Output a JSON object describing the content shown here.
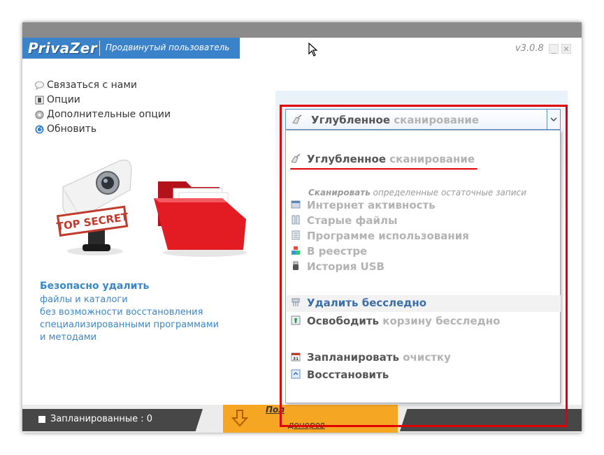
{
  "app": {
    "logo": "PrivaZer",
    "mode": "Продвинутый пользователь",
    "version": "v3.0.8"
  },
  "window_controls": {
    "minimize": "_",
    "close": "✕"
  },
  "menu": [
    {
      "label": "Связаться с нами",
      "icon": "speech-bubble-icon"
    },
    {
      "label": "Опции",
      "icon": "options-icon"
    },
    {
      "label": "Дополнительные опции",
      "icon": "gear-icon"
    },
    {
      "label": "Обновить",
      "icon": "refresh-icon"
    }
  ],
  "illustration": {
    "stamp": "TOP SECRET"
  },
  "description": {
    "heading": "Безопасно удалить",
    "lines": [
      "файлы и каталоги",
      "без возможности восстановления",
      "специализированными программами",
      "и методами"
    ]
  },
  "combo": {
    "bold": "Углубленное",
    "light": "сканирование"
  },
  "dropdown": {
    "selected": {
      "bold": "Углубленное",
      "light": "сканирование"
    },
    "section": {
      "bold": "Сканировать",
      "light": "определенные остаточные записи"
    },
    "items": [
      {
        "label": "Интернет активность",
        "icon": "browser-icon"
      },
      {
        "label": "Старые файлы",
        "icon": "files-icon"
      },
      {
        "label": "Программе использования",
        "icon": "program-icon"
      },
      {
        "label": "В реестре",
        "icon": "registry-icon"
      },
      {
        "label": "История USB",
        "icon": "usb-icon"
      }
    ],
    "delete": {
      "bold": "Удалить",
      "light": "бесследно"
    },
    "recycle": {
      "bold": "Освободить",
      "light": "корзину бесследно"
    },
    "schedule": {
      "bold": "Запланировать",
      "light": "очистку"
    },
    "restore": {
      "label": "Восстановить"
    }
  },
  "bottom": {
    "scheduled": "Запланированные : 0",
    "link_top": "Пол",
    "link_bottom": "доноров"
  },
  "colors": {
    "accent": "#3a82c9",
    "highlight": "#e00000",
    "orange": "#f5a623"
  }
}
